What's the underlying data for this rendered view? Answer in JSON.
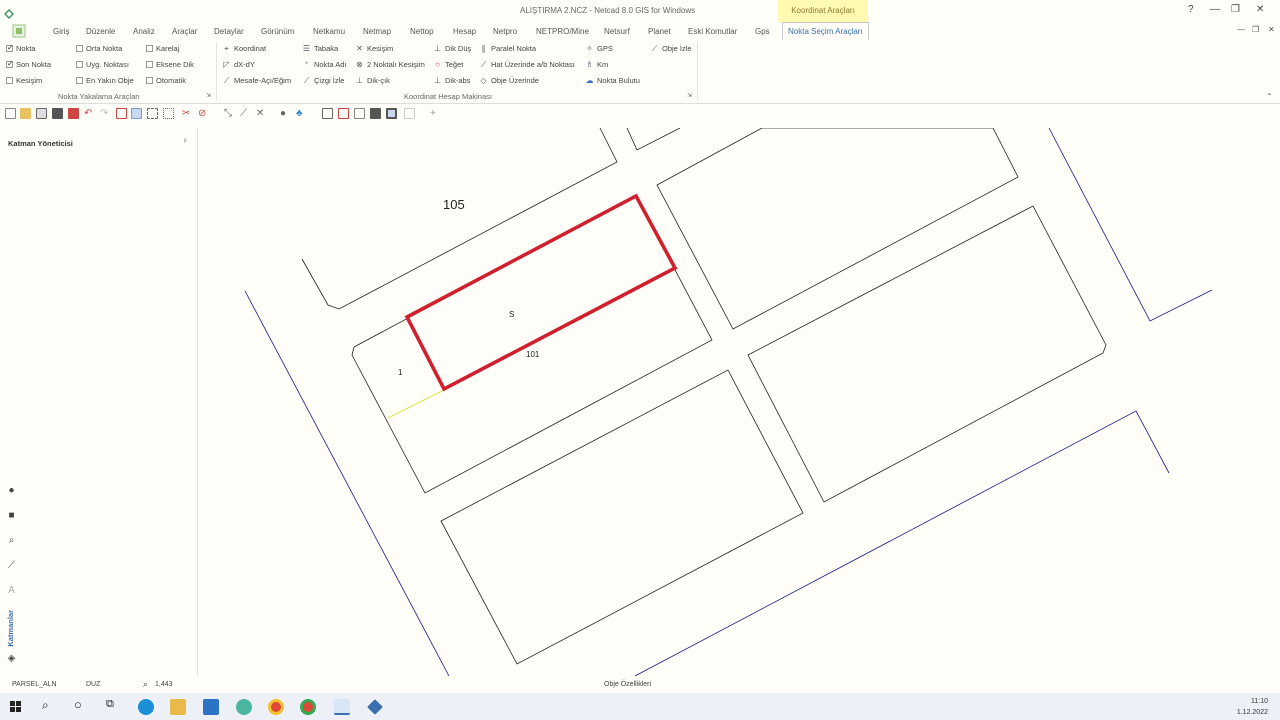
{
  "window": {
    "title": "ALIŞTIRMA 2.NCZ - Netcad 8.0 GIS for Windows",
    "context_tab": "Koordinat Araçları",
    "buttons": [
      "?",
      "—",
      "❐",
      "✕"
    ],
    "doc_buttons": [
      "—",
      "❐",
      "✕"
    ]
  },
  "menu": [
    "Giriş",
    "Düzenle",
    "Analiz",
    "Araçlar",
    "Detaylar",
    "Görünüm",
    "Netkamu",
    "Netmap",
    "Nettop",
    "Hesap",
    "Netpro",
    "NETPRO/Mine",
    "Netsurf",
    "Planet",
    "Eski Komutlar",
    "Gps",
    "Nokta Seçim Araçları"
  ],
  "ribbon": {
    "snap": {
      "col1": [
        {
          "label": "Nokta",
          "checked": true
        },
        {
          "label": "Son Nokta",
          "checked": true
        },
        {
          "label": "Kesişim",
          "checked": false
        }
      ],
      "col2": [
        {
          "label": "Orta Nokta",
          "checked": false
        },
        {
          "label": "Uyg. Noktası",
          "checked": false
        },
        {
          "label": "En Yakın Obje",
          "checked": false
        }
      ],
      "col3": [
        {
          "label": "Karelaj",
          "checked": false
        },
        {
          "label": "Eksene Dik",
          "checked": false
        },
        {
          "label": "Otomatik",
          "checked": false
        }
      ],
      "group_label": "Nokta Yakalama Araçları"
    },
    "coord": {
      "col1": [
        "Koordinat",
        "dX-dY",
        "Mesafe-Açı/Eğim"
      ],
      "col2": [
        "Tabaka",
        "Nokta Adı",
        "Çizgi İzle"
      ],
      "col3": [
        "Kesişim",
        "2 Noktalı Kesişim",
        "Dik-çık"
      ],
      "col4": [
        "Dik Düş",
        "Teğet",
        "Dik-abs"
      ],
      "col5": [
        "Paralel Nokta",
        "Hat Üzerinde a/b Noktası",
        "Obje Üzerinde"
      ],
      "col6": [
        "GPS",
        "Km",
        "Nokta Bulutu"
      ],
      "col7": [
        "Obje İzle"
      ],
      "group_label": "Koordinat Hesap Makinası"
    }
  },
  "left_panel": {
    "title": "Katman Yöneticisi",
    "pin": "ᵖ",
    "tab_label": "Katmanlar"
  },
  "map": {
    "labels": {
      "block": "105",
      "selected": "S",
      "parcel": "101",
      "small": "1"
    },
    "colors": {
      "selection": "#d0202e",
      "road": "#1a1a8a",
      "parcel": "#222222",
      "highlight": "#e8e060"
    }
  },
  "status": {
    "layer": "PARSEL_ALN",
    "mode": "DUZ",
    "zoom": "1,443",
    "center": "Obje Özellikleri"
  },
  "taskbar": {
    "time": "11:10",
    "date": "1.12.2022"
  }
}
